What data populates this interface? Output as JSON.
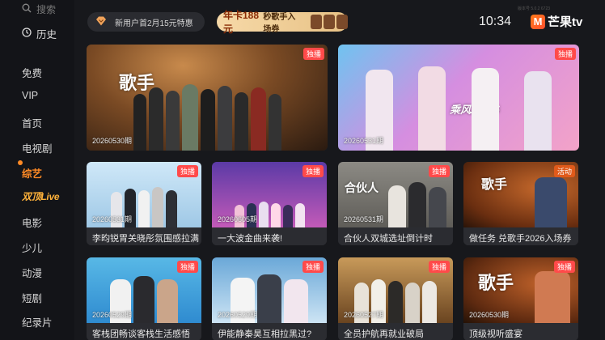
{
  "sidebar": {
    "search_label": "搜索",
    "history_label": "历史",
    "items": [
      {
        "label": "免费",
        "state": "normal"
      },
      {
        "label": "VIP",
        "state": "normal"
      },
      {
        "label": "首页",
        "state": "normal"
      },
      {
        "label": "电视剧",
        "state": "normal"
      },
      {
        "label": "综艺",
        "state": "active"
      },
      {
        "label": "双顶Live",
        "state": "special"
      },
      {
        "label": "电影",
        "state": "normal"
      },
      {
        "label": "少儿",
        "state": "normal"
      },
      {
        "label": "动漫",
        "state": "normal"
      },
      {
        "label": "短剧",
        "state": "normal"
      },
      {
        "label": "纪录片",
        "state": "normal"
      }
    ]
  },
  "topbar": {
    "promo1_text": "新用户首2月15元特惠",
    "promo2_big": "年卡188元",
    "promo2_text": "秒歌手入场券",
    "clock": "10:34",
    "logo_text": "芒果tv",
    "version_text": "版本号 5.0.2 6723"
  },
  "featured": [
    {
      "period": "20260530期",
      "badge": "独播",
      "show": "歌手"
    },
    {
      "period": "20260531期",
      "badge": "独播",
      "show": "乘风2026"
    }
  ],
  "grid": [
    {
      "period": "20260531期",
      "badge": "独播",
      "caption": "李昀锐胃关晓彤氛围感拉满"
    },
    {
      "period": "20260605期",
      "badge": "独播",
      "caption": "一大波金曲来袭!"
    },
    {
      "period": "20260531期",
      "badge": "独播",
      "caption": "合伙人双城选址倒计时"
    },
    {
      "period": "",
      "badge": "活动",
      "caption": "做任务 兑歌手2026入场券"
    },
    {
      "period": "20260529期",
      "badge": "独播",
      "caption": "客栈团畅谈客栈生活感悟"
    },
    {
      "period": "20260529期",
      "badge": "独播",
      "caption": "伊能静秦昊互相拉黑过?"
    },
    {
      "period": "20260527期",
      "badge": "独播",
      "caption": "全员护航再就业破局"
    },
    {
      "period": "20260530期",
      "badge": "独播",
      "caption": "顶级视听盛宴"
    }
  ],
  "colors": {
    "background": "#17181c",
    "accent_orange": "#ff8a25",
    "badge_red": "#ff4a4a",
    "logo_orange": "#ff6a1f"
  }
}
